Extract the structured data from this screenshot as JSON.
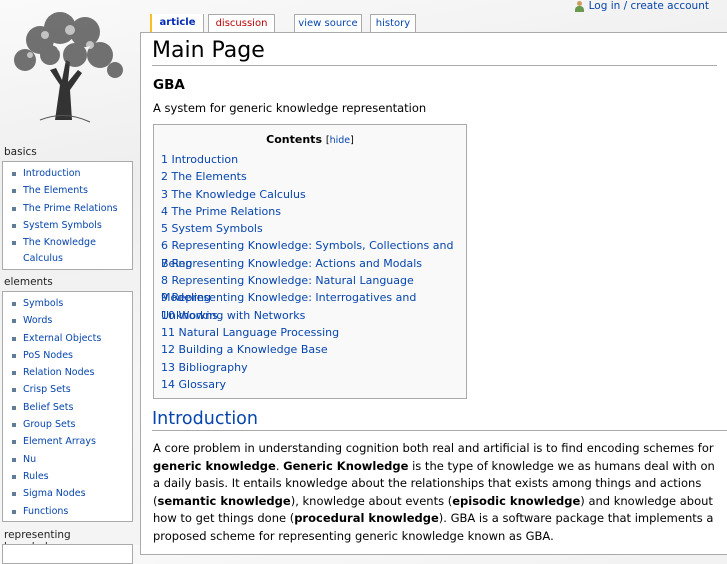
{
  "personal": {
    "login": "Log in / create account"
  },
  "tabs": [
    {
      "label": "article"
    },
    {
      "label": "discussion"
    },
    {
      "label": "view source"
    },
    {
      "label": "history"
    }
  ],
  "page": {
    "title": "Main Page",
    "heading": "GBA",
    "subtitle": "A system for generic knowledge representation"
  },
  "toc": {
    "title": "Contents",
    "hide": "hide",
    "items": [
      "1 Introduction",
      "2 The Elements",
      "3 The Knowledge Calculus",
      "4 The Prime Relations",
      "5 System Symbols",
      "6 Representing Knowledge: Symbols, Collections and Being",
      "7 Representing Knowledge: Actions and Modals",
      "8 Representing Knowledge: Natural Language Modeling",
      "9 Representing Knowledge: Interrogatives and Unknowns",
      "10 Working with Networks",
      "11 Natural Language Processing",
      "12 Building a Knowledge Base",
      "13 Bibliography",
      "14 Glossary"
    ]
  },
  "intro": {
    "heading": "Introduction",
    "segments": [
      "A core problem in understanding cognition both real and artificial is to find encoding schemes for ",
      "generic knowledge",
      ". ",
      "Generic Knowledge",
      " is the type of knowledge we as humans deal with on a daily basis. It entails knowledge about the relationships that exists among things and actions (",
      "semantic knowledge",
      "), knowledge about events (",
      "episodic knowledge",
      ") and knowledge about how to get things done (",
      "procedural knowledge",
      "). GBA is a software package that implements a proposed scheme for representing generic knowledge known as GBA."
    ]
  },
  "sidebar": {
    "basics": {
      "label": "basics",
      "items": [
        "Introduction",
        "The Elements",
        "The Prime Relations",
        "System Symbols",
        "The Knowledge Calculus"
      ]
    },
    "elements": {
      "label": "elements",
      "items": [
        "Symbols",
        "Words",
        "External Objects",
        "PoS Nodes",
        "Relation Nodes",
        "Crisp Sets",
        "Belief Sets",
        "Group Sets",
        "Element Arrays",
        "Nu",
        "Rules",
        "Sigma Nodes",
        "Functions"
      ]
    },
    "representing": {
      "label": "representing knowledge"
    }
  }
}
